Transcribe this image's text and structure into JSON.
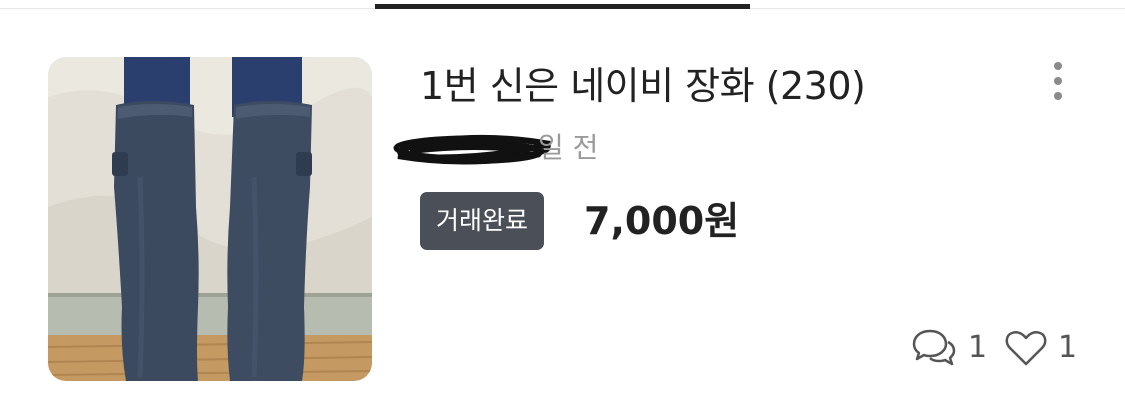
{
  "item": {
    "title": "1번 신은 네이비 장화 (230)",
    "time_ago": "일 전",
    "status": "거래완료",
    "price": "7,000원",
    "chat_count": "1",
    "like_count": "1",
    "image_icon": "rain-boots-photo",
    "badge_color": "#4b4f57",
    "tab_indicator_color": "#222222"
  }
}
